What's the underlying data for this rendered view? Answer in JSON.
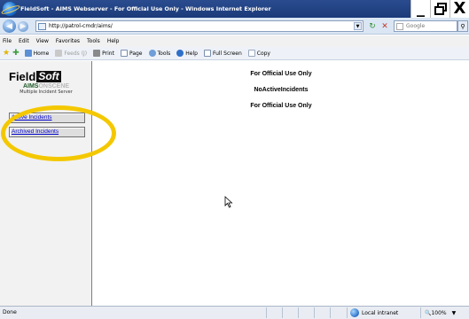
{
  "window": {
    "title": "FieldSoft - AIMS Webserver - For Official Use Only - Windows Internet Explorer",
    "minimize": "_",
    "restore": "Έ",
    "close": "X"
  },
  "address": {
    "url": "http://patrol-cmdr/aims/"
  },
  "search": {
    "placeholder": "Google"
  },
  "menu": {
    "items": [
      "File",
      "Edit",
      "View",
      "Favorites",
      "Tools",
      "Help"
    ]
  },
  "toolbar": {
    "home": "Home",
    "feeds": "Feeds (J)",
    "print": "Print",
    "page": "Page",
    "tools": "Tools",
    "help": "Help",
    "fullscreen": "Full Screen",
    "copy": "Copy"
  },
  "logo": {
    "field": "Field",
    "soft": "Soft",
    "aims": "AIMS",
    "scene": "ONSCENE",
    "subtitle": "Multiple Incident Server"
  },
  "nav": {
    "active": "Active Incidents",
    "archived": "Archived Incidents"
  },
  "main": {
    "banner_top": "For Official Use Only",
    "status": "NoActiveIncidents",
    "banner_bottom": "For Official Use Only"
  },
  "status": {
    "text": "Done",
    "zone": "Local intranet",
    "zoom": "100%"
  },
  "colors": {
    "highlight_ring": "#f4c800",
    "title_bar": "#2a4c8f",
    "link": "#0000cc"
  }
}
